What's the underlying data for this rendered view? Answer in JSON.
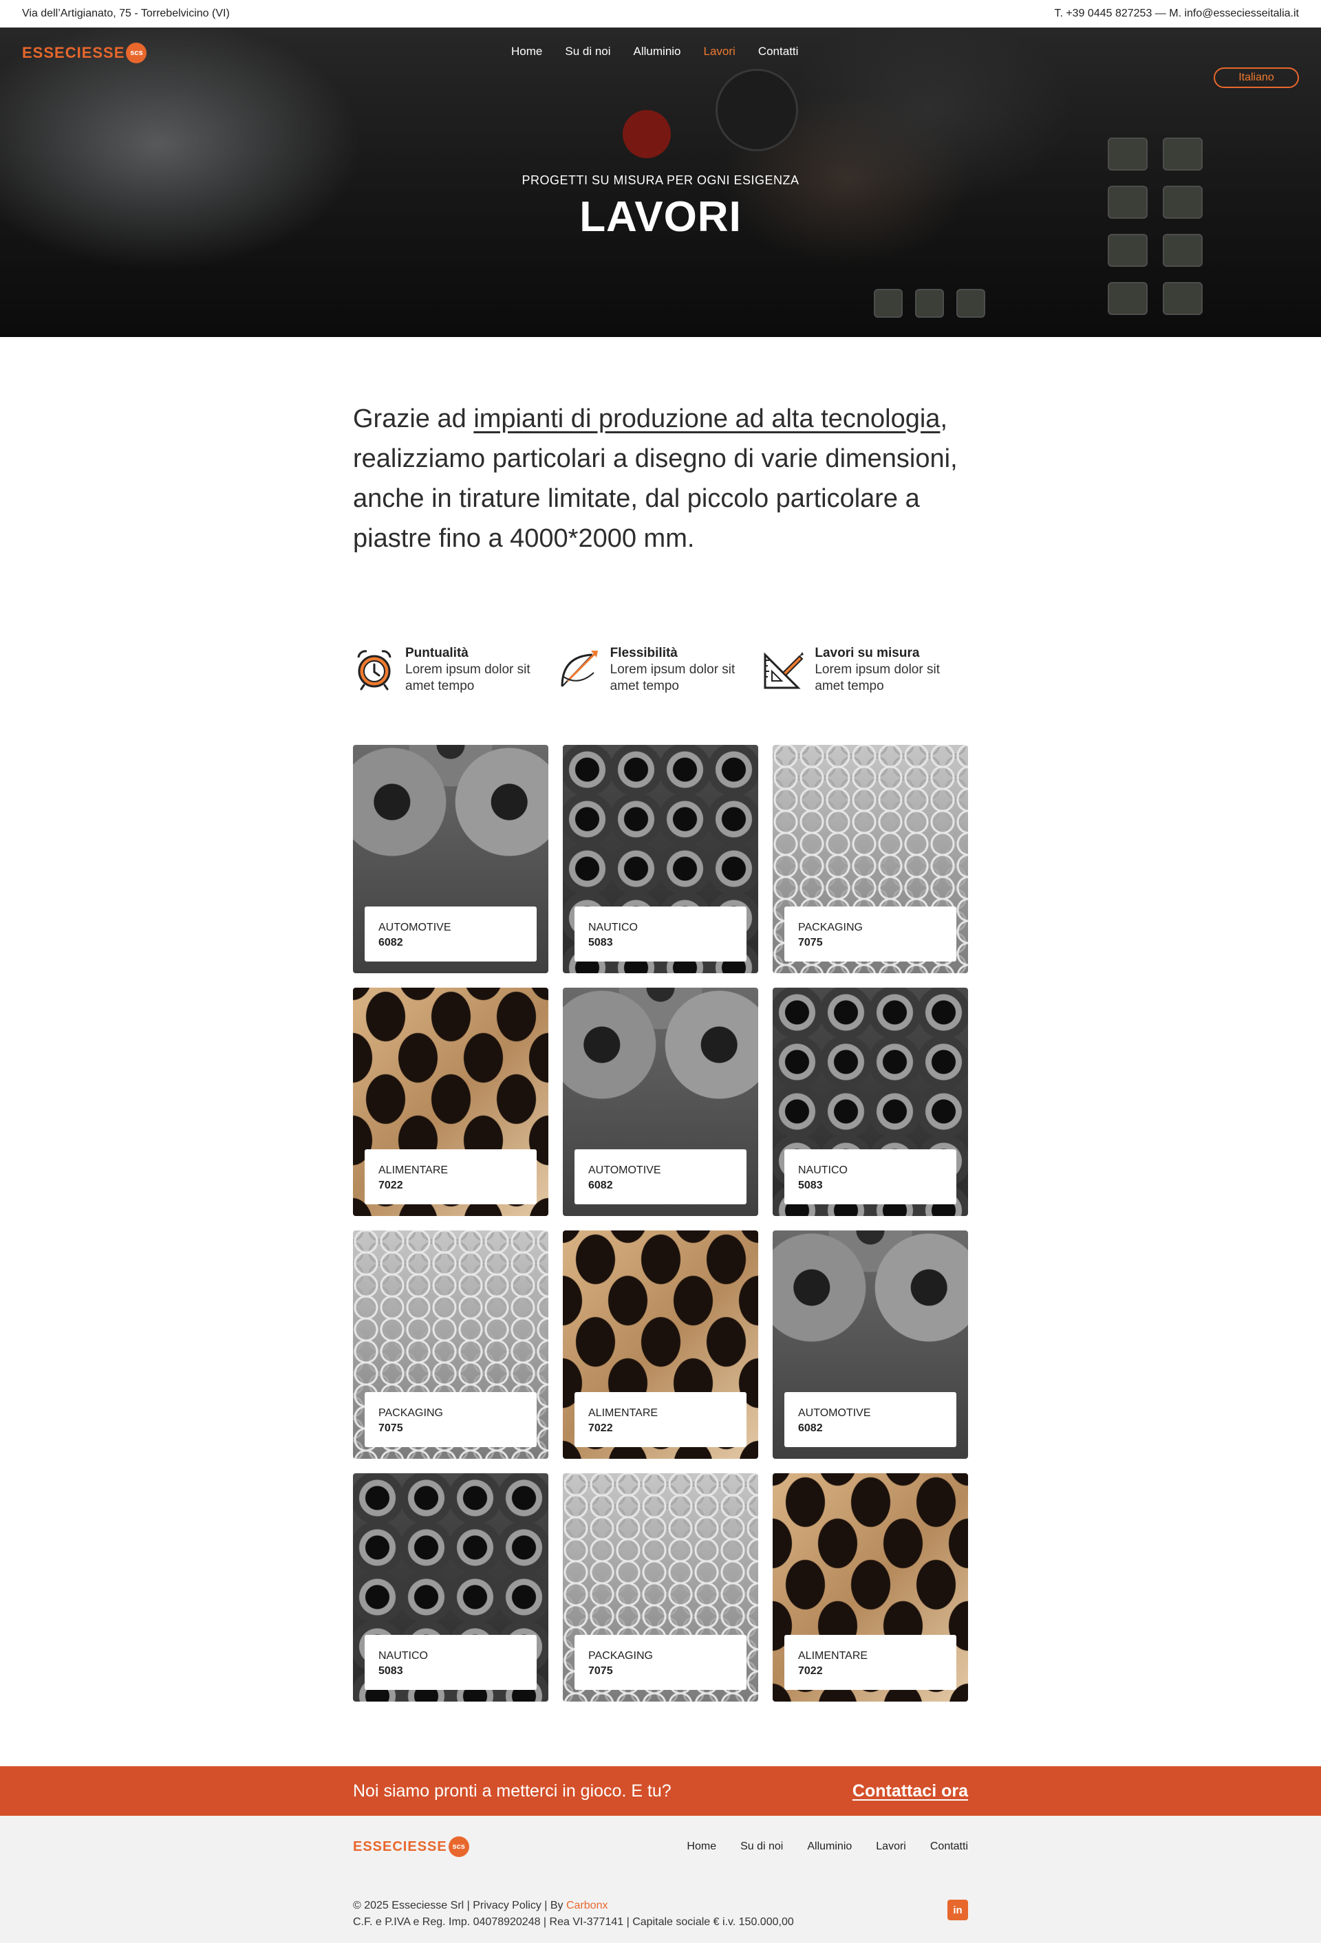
{
  "topbar": {
    "address": "Via dell’Artigianato, 75 - Torrebelvicino (VI)",
    "contacts": "T. +39 0445 827253 — M. info@esseciesseitalia.it"
  },
  "brand": {
    "logo_text": "ESSECIESSE",
    "badge_text": "scs",
    "accent_color": "#e8672c",
    "cta_color": "#d4502a"
  },
  "nav": {
    "items": [
      {
        "label": "Home"
      },
      {
        "label": "Su di noi"
      },
      {
        "label": "Alluminio"
      },
      {
        "label": "Lavori",
        "active": true
      },
      {
        "label": "Contatti"
      }
    ],
    "language": "Italiano"
  },
  "hero": {
    "subtitle": "PROGETTI SU MISURA PER OGNI ESIGENZA",
    "title": "LAVORI"
  },
  "intro": {
    "before": "Grazie ad ",
    "link": "impianti di produzione ad alta tecnologia",
    "after": ", realizziamo particolari a disegno di varie dimensioni, anche in tirature limitate, dal piccolo particolare a piastre fino a 4000*2000 mm."
  },
  "features": [
    {
      "icon": "alarm-clock-icon",
      "title": "Puntualità",
      "desc": "Lorem ipsum dolor sit amet tempo"
    },
    {
      "icon": "archery-bow-icon",
      "title": "Flessibilità",
      "desc": "Lorem ipsum dolor sit amet tempo"
    },
    {
      "icon": "ruler-set-square-icon",
      "title": "Lavori su misura",
      "desc": "Lorem ipsum dolor sit amet tempo"
    }
  ],
  "works": [
    {
      "category": "AUTOMOTIVE",
      "code": "6082",
      "texture": "washers"
    },
    {
      "category": "NAUTICO",
      "code": "5083",
      "texture": "nuts"
    },
    {
      "category": "PACKAGING",
      "code": "7075",
      "texture": "chain"
    },
    {
      "category": "ALIMENTARE",
      "code": "7022",
      "texture": "holes"
    },
    {
      "category": "AUTOMOTIVE",
      "code": "6082",
      "texture": "washers"
    },
    {
      "category": "NAUTICO",
      "code": "5083",
      "texture": "nuts"
    },
    {
      "category": "PACKAGING",
      "code": "7075",
      "texture": "chain"
    },
    {
      "category": "ALIMENTARE",
      "code": "7022",
      "texture": "holes"
    },
    {
      "category": "AUTOMOTIVE",
      "code": "6082",
      "texture": "washers"
    },
    {
      "category": "NAUTICO",
      "code": "5083",
      "texture": "nuts"
    },
    {
      "category": "PACKAGING",
      "code": "7075",
      "texture": "chain"
    },
    {
      "category": "ALIMENTARE",
      "code": "7022",
      "texture": "holes"
    }
  ],
  "cta": {
    "text": "Noi siamo pronti a metterci in gioco. E tu?",
    "link": "Contattaci ora"
  },
  "footer": {
    "menu": [
      {
        "label": "Home"
      },
      {
        "label": "Su di noi"
      },
      {
        "label": "Alluminio"
      },
      {
        "label": "Lavori"
      },
      {
        "label": "Contatti"
      }
    ],
    "copyright": "© 2025 Esseciesse Srl | Privacy Policy | By ",
    "agency": "Carbonx",
    "legal": "C.F. e P.IVA e Reg. Imp. 04078920248 | Rea VI-377141 | Capitale sociale € i.v. 150.000,00",
    "social_icon": "linkedin-icon",
    "social_text": "in"
  }
}
